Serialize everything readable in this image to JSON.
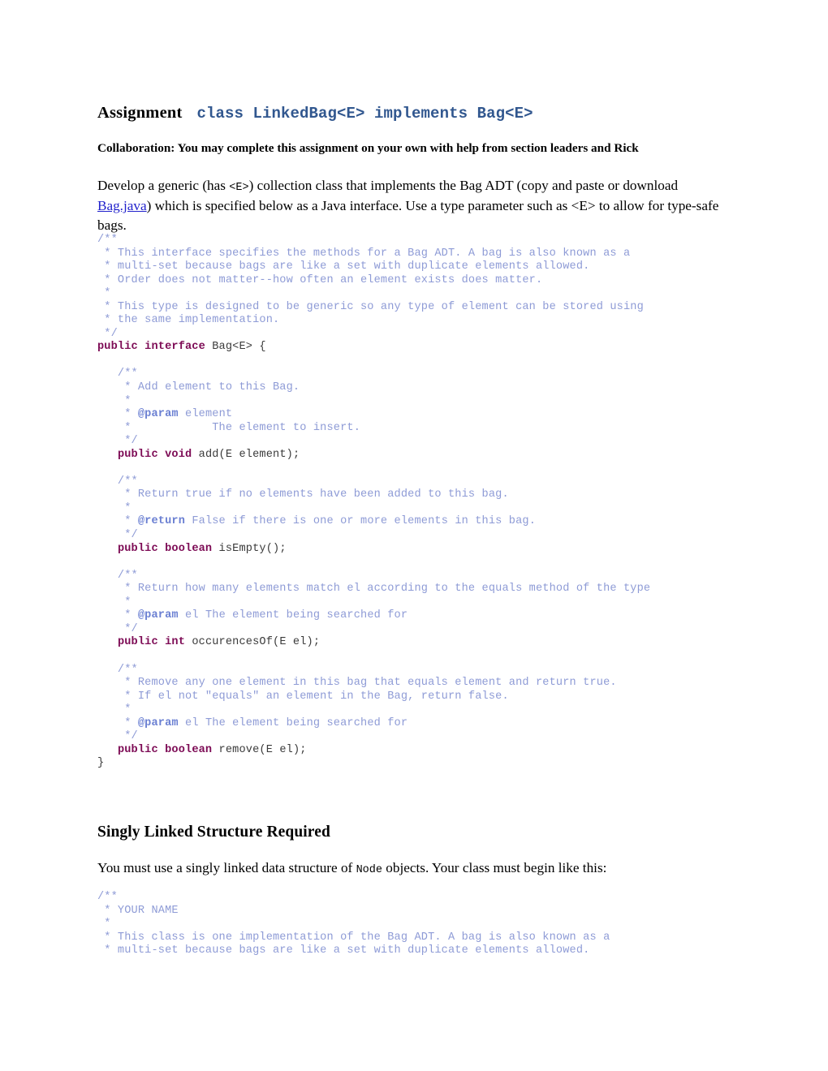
{
  "document": {
    "heading": {
      "label": "Assignment",
      "code_title": "class LinkedBag<E> implements Bag<E>"
    },
    "collaboration": "Collaboration:  You may complete this assignment on your own with help from section leaders and Rick",
    "intro": {
      "part1": "Develop a generic (has ",
      "code1": "<E>",
      "part2": ") collection class that implements the Bag ADT (copy and paste or download ",
      "link": "Bag.java",
      "part3": ") which is specified below as a Java interface. Use a type parameter such as <E> to allow for type-safe bags."
    },
    "section2": {
      "heading": "Singly Linked Structure Required",
      "part1": "You must use a singly linked data structure of ",
      "code1": "Node",
      "part2": "  objects. Your class must begin like this:"
    },
    "code_interface": {
      "lines": [
        {
          "t": "cmt",
          "s": "/**"
        },
        {
          "t": "cmt",
          "s": " * This interface specifies the methods for a Bag ADT. A bag is also known as a"
        },
        {
          "t": "cmt",
          "s": " * multi-set because bags are like a set with duplicate elements allowed."
        },
        {
          "t": "cmt",
          "s": " * Order does not matter--how often an element exists does matter."
        },
        {
          "t": "cmt",
          "s": " *"
        },
        {
          "t": "cmt",
          "s": " * This type is designed to be generic so any type of element can be stored using"
        },
        {
          "t": "cmt",
          "s": " * the same implementation."
        },
        {
          "t": "cmt",
          "s": " */"
        },
        {
          "t": "mix",
          "kw": "public interface",
          "rest": " Bag<E> {"
        },
        {
          "t": "cmt",
          "s": ""
        },
        {
          "t": "cmt",
          "s": "   /**"
        },
        {
          "t": "cmt",
          "s": "    * Add element to this Bag."
        },
        {
          "t": "cmt",
          "s": "    *"
        },
        {
          "t": "tagline",
          "pre": "    * ",
          "tag": "@param",
          "post": " element"
        },
        {
          "t": "cmt",
          "s": "    *            The element to insert."
        },
        {
          "t": "cmt",
          "s": "    */"
        },
        {
          "t": "mix",
          "indent": "   ",
          "kw": "public void",
          "rest": " add(E element);"
        },
        {
          "t": "cmt",
          "s": ""
        },
        {
          "t": "cmt",
          "s": "   /**"
        },
        {
          "t": "cmt",
          "s": "    * Return true if no elements have been added to this bag."
        },
        {
          "t": "cmt",
          "s": "    *"
        },
        {
          "t": "tagline",
          "pre": "    * ",
          "tag": "@return",
          "post": " False if there is one or more elements in this bag."
        },
        {
          "t": "cmt",
          "s": "    */"
        },
        {
          "t": "mix",
          "indent": "   ",
          "kw": "public boolean",
          "rest": " isEmpty();"
        },
        {
          "t": "cmt",
          "s": ""
        },
        {
          "t": "cmt",
          "s": "   /**"
        },
        {
          "t": "cmt",
          "s": "    * Return how many elements match el according to the equals method of the type"
        },
        {
          "t": "cmt",
          "s": "    *"
        },
        {
          "t": "tagline",
          "pre": "    * ",
          "tag": "@param",
          "post": " el The element being searched for"
        },
        {
          "t": "cmt",
          "s": "    */"
        },
        {
          "t": "mix",
          "indent": "   ",
          "kw": "public int",
          "rest": " occurencesOf(E el);"
        },
        {
          "t": "cmt",
          "s": ""
        },
        {
          "t": "cmt",
          "s": "   /**"
        },
        {
          "t": "cmt",
          "s": "    * Remove any one element in this bag that equals element and return true."
        },
        {
          "t": "cmt",
          "s": "    * If el not \"equals\" an element in the Bag, return false."
        },
        {
          "t": "cmt",
          "s": "    *"
        },
        {
          "t": "tagline",
          "pre": "    * ",
          "tag": "@param",
          "post": " el The element being searched for"
        },
        {
          "t": "cmt",
          "s": "    */"
        },
        {
          "t": "mix",
          "indent": "   ",
          "kw": "public boolean",
          "rest": " remove(E el);"
        },
        {
          "t": "plain",
          "s": "}"
        }
      ]
    },
    "code_class": {
      "lines": [
        {
          "t": "cmt",
          "s": "/**"
        },
        {
          "t": "cmt",
          "s": " * YOUR NAME"
        },
        {
          "t": "cmt",
          "s": " *"
        },
        {
          "t": "cmt",
          "s": " * This class is one implementation of the Bag ADT. A bag is also known as a"
        },
        {
          "t": "cmt",
          "s": " * multi-set because bags are like a set with duplicate elements allowed."
        }
      ]
    },
    "colors": {
      "title_code": "#31578F",
      "comment": "#8E9BD6",
      "javadoc_tag": "#6A7FD2",
      "keyword": "#7D0B55",
      "link": "#2222CC"
    }
  }
}
